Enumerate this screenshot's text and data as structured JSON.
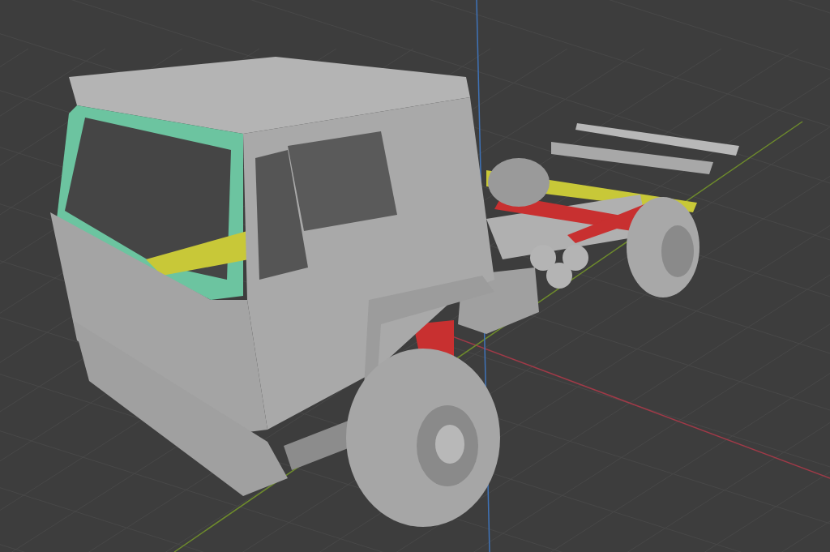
{
  "viewport": {
    "axes": [
      {
        "kind": "x",
        "color": "#a03a48"
      },
      {
        "kind": "y",
        "color": "#6e8b2c"
      },
      {
        "kind": "z",
        "color": "#3f73b8"
      }
    ]
  }
}
